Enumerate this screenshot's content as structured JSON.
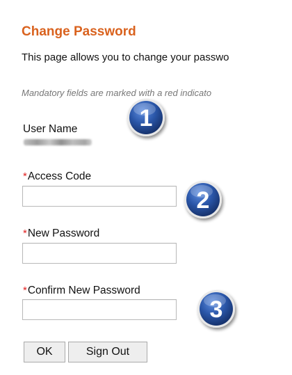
{
  "page": {
    "title": "Change Password",
    "description": "This page allows you to change your passwo",
    "mandatory_note": "Mandatory fields are marked with a red indicato",
    "required_marker": "*"
  },
  "form": {
    "user_name_label": "User Name",
    "access_code_label": "Access Code",
    "access_code_value": "",
    "new_password_label": "New Password",
    "new_password_value": "",
    "confirm_password_label": "Confirm New Password",
    "confirm_password_value": ""
  },
  "buttons": {
    "ok": "OK",
    "sign_out": "Sign Out"
  },
  "badges": {
    "one": "1",
    "two": "2",
    "three": "3",
    "color": "#2a56a8"
  },
  "colors": {
    "title": "#d9621e",
    "required": "#e02020"
  }
}
